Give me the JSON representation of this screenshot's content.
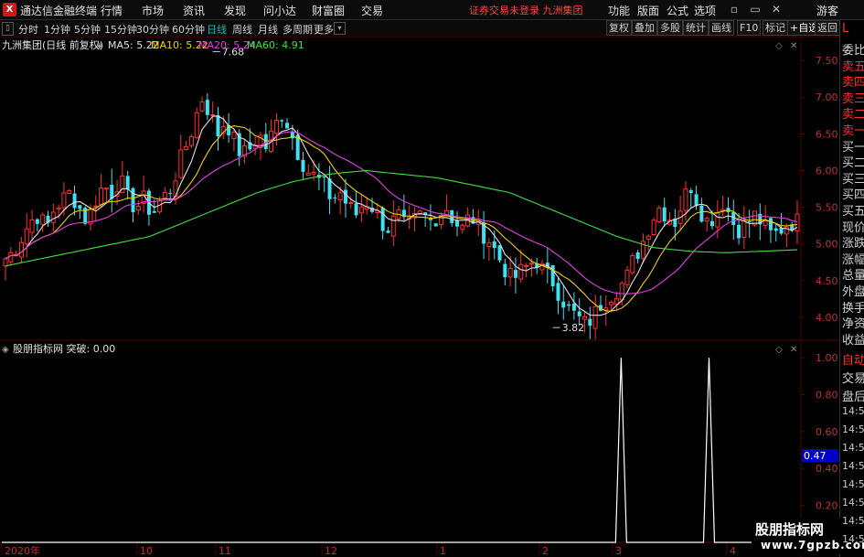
{
  "titlebar": {
    "app_name": "通达信金融终端",
    "menus": [
      "行情",
      "市场",
      "资讯",
      "发现",
      "问小达",
      "财富圈",
      "交易"
    ],
    "notice": "证券交易未登录 九洲集团",
    "right_menus": [
      "功能",
      "版面",
      "公式",
      "选项"
    ],
    "user": "游客"
  },
  "toolbar": {
    "periods": [
      "分时",
      "1分钟",
      "5分钟",
      "15分钟",
      "30分钟",
      "60分钟",
      "日线",
      "周线",
      "月线",
      "多周期",
      "更多"
    ],
    "active_period": "日线",
    "right_tools": [
      "复权",
      "叠加",
      "多股",
      "统计",
      "画线",
      "F10",
      "标记",
      "+自选",
      "返回"
    ]
  },
  "main_chart": {
    "stock_title": "九洲集团(日线 前复权)",
    "ma_legend": [
      {
        "label": "MA5: 5.22",
        "color": "#e0e0e0"
      },
      {
        "label": "MA10: 5.22",
        "color": "#f0d000"
      },
      {
        "label": "MA20: 5.24",
        "color": "#e040e0"
      },
      {
        "label": "MA60: 4.91",
        "color": "#40e040"
      }
    ],
    "high_label": "7.68",
    "low_label": "3.82",
    "price_ticks": [
      "7.50",
      "7.00",
      "6.50",
      "6.00",
      "5.50",
      "5.00",
      "4.50",
      "4.00"
    ]
  },
  "sub_chart": {
    "title": "股朋指标网 突破: 0.00",
    "ticks": [
      "1.00",
      "0.80",
      "0.60",
      "0.40",
      "0.20"
    ],
    "current_value": "0.47"
  },
  "x_axis": {
    "labels": [
      "2020年",
      "10",
      "11",
      "12",
      "1",
      "2",
      "3",
      "4"
    ]
  },
  "side_panel": {
    "top_label": "L",
    "items": [
      "委比",
      "卖五",
      "卖四",
      "卖三",
      "卖二",
      "卖一",
      "买一",
      "买二",
      "买三",
      "买四",
      "买五",
      "现价",
      "涨跌",
      "涨幅",
      "总量",
      "外盘",
      "换手",
      "净资",
      "收益"
    ],
    "red_items": [
      "卖五",
      "卖四",
      "卖三",
      "卖二",
      "卖一"
    ],
    "lower_items": [
      "自动",
      "交易",
      "盘后"
    ],
    "times": [
      "14:56",
      "14:56",
      "14:56",
      "14:56",
      "14:56",
      "14:56",
      "14:56",
      "14:56"
    ]
  },
  "watermark": {
    "line1": "股朋指标网",
    "line2": "www.7gpzb.com"
  },
  "colors": {
    "up": "#ff3030",
    "down": "#40e0f0",
    "ma5": "#e0e0e0",
    "ma10": "#f0d000",
    "ma20": "#e040e0",
    "ma60": "#40e040",
    "grid": "#5a0000"
  },
  "chart_data": {
    "type": "candlestick",
    "x_labels": [
      "2020年",
      "10",
      "11",
      "12",
      "1",
      "2",
      "3",
      "4"
    ],
    "ylim": [
      3.7,
      7.8
    ],
    "price_ticks": [
      7.5,
      7.0,
      6.5,
      6.0,
      5.5,
      5.0,
      4.5,
      4.0
    ],
    "annotations": {
      "high": 7.68,
      "low": 3.82
    },
    "ma_legend": {
      "MA5": 5.22,
      "MA10": 5.22,
      "MA20": 5.24,
      "MA60": 4.91
    },
    "close_path": [
      4.8,
      4.9,
      5.1,
      5.3,
      5.4,
      5.2,
      5.5,
      5.6,
      5.7,
      5.5,
      5.3,
      5.6,
      5.8,
      5.7,
      5.9,
      5.6,
      5.5,
      5.6,
      5.4,
      5.6,
      5.7,
      6.0,
      6.3,
      6.6,
      7.0,
      6.8,
      6.5,
      6.7,
      6.4,
      6.2,
      6.3,
      6.5,
      6.3,
      6.6,
      6.8,
      6.5,
      6.2,
      6.0,
      5.9,
      5.8,
      5.6,
      5.7,
      5.5,
      5.4,
      5.6,
      5.5,
      5.3,
      5.2,
      5.4,
      5.2,
      5.3,
      5.4,
      5.3,
      5.4,
      5.5,
      5.3,
      5.2,
      5.4,
      5.2,
      5.1,
      4.9,
      4.7,
      4.5,
      4.6,
      4.7,
      4.8,
      4.6,
      4.5,
      4.3,
      4.1,
      4.0,
      3.9,
      4.0,
      4.2,
      4.3,
      4.4,
      4.5,
      4.8,
      5.0,
      5.3,
      5.5,
      5.4,
      5.3,
      5.6,
      5.8,
      5.5,
      5.3,
      5.4,
      5.6,
      5.3,
      5.2,
      5.3,
      5.4,
      5.2,
      5.1,
      5.2,
      5.3,
      5.3
    ],
    "ma60_path": [
      4.7,
      4.8,
      4.9,
      5.0,
      5.1,
      5.3,
      5.5,
      5.7,
      5.85,
      5.95,
      6.0,
      5.95,
      5.9,
      5.8,
      5.7,
      5.5,
      5.3,
      5.1,
      4.95,
      4.9,
      4.88,
      4.9,
      4.92
    ],
    "sub_indicator": {
      "name": "突破",
      "value": 0.0,
      "ylim": [
        0,
        1.05
      ],
      "ticks": [
        1.0,
        0.8,
        0.6,
        0.4,
        0.2
      ],
      "spike_positions": [
        0.775,
        0.885
      ],
      "spike_value": 1.0
    }
  }
}
